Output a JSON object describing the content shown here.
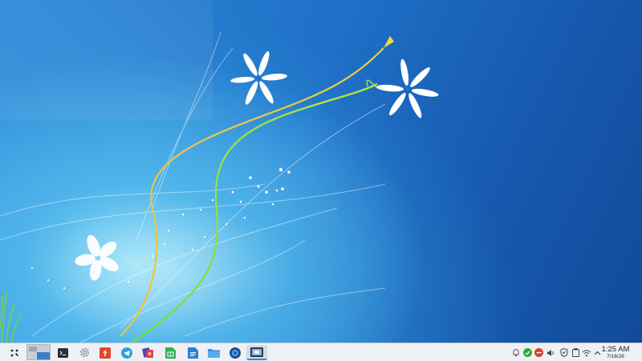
{
  "desktop": {
    "wallpaper": "blue-flower-wallpaper",
    "colors": {
      "sky": "#1e6fc6",
      "glow": "#8fe0f7",
      "stem_green": "#6fdc3a",
      "stem_yellow": "#f0c23a"
    }
  },
  "taskbar": {
    "start_icon": "launcher-icon",
    "pinned": [
      {
        "name": "pager-thumbnail",
        "icon": "desktop-pager-icon"
      },
      {
        "name": "terminal",
        "icon": "terminal-icon"
      },
      {
        "name": "settings",
        "icon": "gear-icon"
      },
      {
        "name": "app-store",
        "icon": "store-icon"
      },
      {
        "name": "telegram",
        "icon": "telegram-icon"
      },
      {
        "name": "media-app",
        "icon": "media-icon"
      },
      {
        "name": "spreadsheet",
        "icon": "spreadsheet-icon"
      },
      {
        "name": "document-writer",
        "icon": "writer-icon"
      },
      {
        "name": "file-manager",
        "icon": "folder-icon"
      },
      {
        "name": "browser",
        "icon": "browser-icon"
      },
      {
        "name": "screenshot-tool",
        "icon": "screenshot-icon",
        "active": true
      }
    ],
    "tray": [
      "notification-icon",
      "status-check-icon",
      "block-icon",
      "volume-icon",
      "shield-icon",
      "clipboard-icon",
      "wifi-icon",
      "chevron-up-icon"
    ],
    "clock": {
      "time": "1:25 AM",
      "date": "7/16/26"
    }
  }
}
